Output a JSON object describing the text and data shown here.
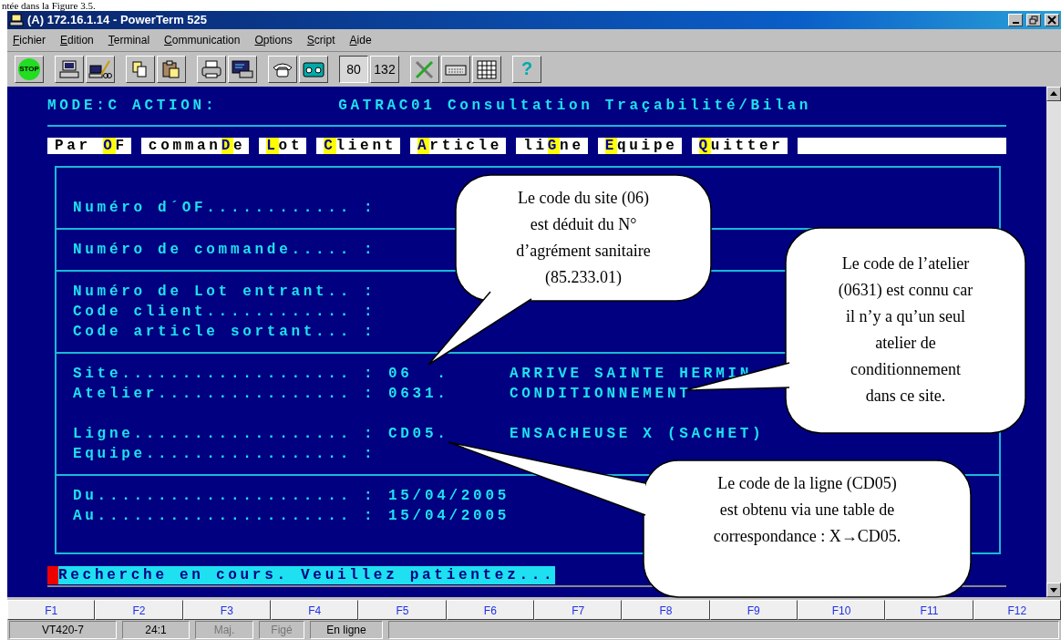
{
  "document_fragment": "ntée dans la Figure 3.5.",
  "window": {
    "title": "(A) 172.16.1.14 - PowerTerm 525"
  },
  "menu": [
    "Fichier",
    "Edition",
    "Terminal",
    "Communication",
    "Options",
    "Script",
    "Aide"
  ],
  "toolbar": {
    "stop_label": "STOP",
    "columns": [
      {
        "label": "80",
        "selected": true
      },
      {
        "label": "132",
        "selected": false
      }
    ],
    "help_label": "?"
  },
  "terminal": {
    "header": {
      "mode": "MODE:C ACTION:",
      "screen_title": "GATRAC01 Consultation Traçabilité/Bilan"
    },
    "actions": [
      {
        "before": "Par ",
        "key": "O",
        "after": "F"
      },
      {
        "before": "comman",
        "key": "D",
        "after": "e"
      },
      {
        "key": "L",
        "after": "ot"
      },
      {
        "key": "C",
        "after": "lient"
      },
      {
        "key": "A",
        "after": "rticle"
      },
      {
        "before": "li",
        "key": "G",
        "after": "ne"
      },
      {
        "key": "E",
        "after": "quipe"
      },
      {
        "key": "Q",
        "after": "uitter"
      }
    ],
    "sections": [
      {
        "groups": [
          [
            {
              "label": "Numéro d´OF............",
              "colon": ":"
            }
          ]
        ]
      },
      {
        "groups": [
          [
            {
              "label": "Numéro de commande.....",
              "colon": ":"
            }
          ]
        ]
      },
      {
        "groups": [
          [
            {
              "label": "Numéro de Lot entrant..",
              "colon": ":"
            },
            {
              "label": "Code client............",
              "colon": ":"
            },
            {
              "label": "Code article sortant...",
              "colon": ":"
            }
          ]
        ]
      },
      {
        "groups": [
          [
            {
              "label": "Site...................",
              "colon": ":",
              "value": "06  .",
              "description": "ARRIVE SAINTE HERMIN"
            },
            {
              "label": "Atelier................",
              "colon": ":",
              "value": "0631.",
              "description": "CONDITIONNEMENT"
            }
          ],
          [
            {
              "label": "Ligne..................",
              "colon": ":",
              "value": "CD05.",
              "description": "ENSACHEUSE X (SACHET)"
            },
            {
              "label": "Equipe.................",
              "colon": ":"
            }
          ]
        ]
      },
      {
        "groups": [
          [
            {
              "label": "Du.....................",
              "colon": ":",
              "value": "15/04/2005"
            },
            {
              "label": "Au.....................",
              "colon": ":",
              "value": "15/04/2005"
            }
          ]
        ]
      }
    ],
    "message": "Recherche en cours. Veuillez patientez..."
  },
  "callouts": [
    {
      "lines": [
        "Le code du site (06)",
        "est déduit du N°",
        "d’agrément sanitaire",
        "(85.233.01)"
      ]
    },
    {
      "lines": [
        "Le code de l’atelier",
        "(0631) est connu car",
        "il n’y a qu’un seul",
        "atelier de",
        "conditionnement",
        "dans ce site."
      ]
    },
    {
      "lines": [
        "Le code de la ligne (CD05)",
        "est obtenu via une table de",
        "correspondance : X→CD05."
      ]
    }
  ],
  "function_keys": [
    "F1",
    "F2",
    "F3",
    "F4",
    "F5",
    "F6",
    "F7",
    "F8",
    "F9",
    "F10",
    "F11",
    "F12"
  ],
  "status_bar": [
    {
      "text": "VT420-7",
      "disabled": false
    },
    {
      "text": "24:1",
      "disabled": false
    },
    {
      "text": "Maj.",
      "disabled": true
    },
    {
      "text": "Figé",
      "disabled": true
    },
    {
      "text": "En ligne",
      "disabled": false
    }
  ]
}
